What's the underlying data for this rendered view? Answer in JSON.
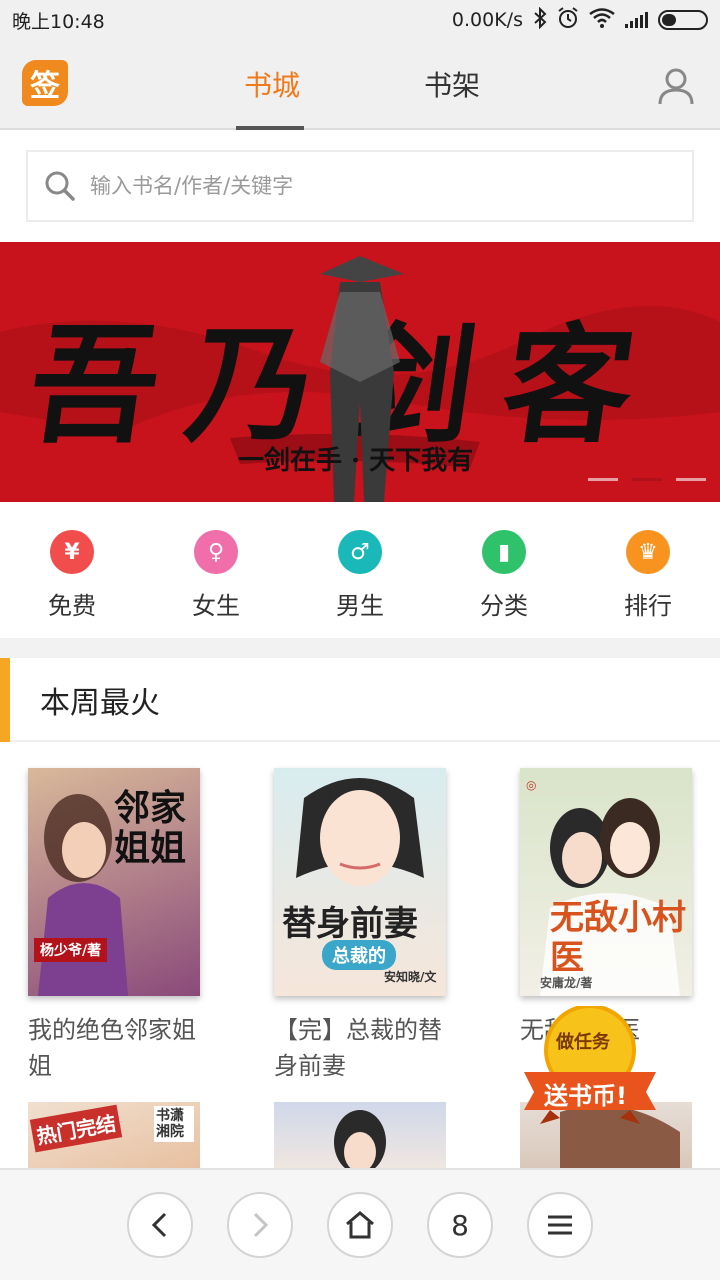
{
  "status_bar": {
    "time": "晚上10:48",
    "network_speed": "0.00K/s"
  },
  "header": {
    "logo_text": "签",
    "tabs": [
      {
        "label": "书城",
        "active": true
      },
      {
        "label": "书架",
        "active": false
      }
    ]
  },
  "search": {
    "placeholder": "输入书名/作者/关键字"
  },
  "banner": {
    "title": "吾乃剑客",
    "subtitle": "一剑在手 · 天下我有",
    "active_dot": 2,
    "dot_count": 3
  },
  "categories": [
    {
      "label": "免费",
      "icon": "yen-icon",
      "glyph": "¥",
      "color": "#f24d4d"
    },
    {
      "label": "女生",
      "icon": "female-icon",
      "glyph": "♀",
      "color": "#f06ea9"
    },
    {
      "label": "男生",
      "icon": "male-icon",
      "glyph": "♂",
      "color": "#1ab8b8"
    },
    {
      "label": "分类",
      "icon": "book-icon",
      "glyph": "▮",
      "color": "#2fc26a"
    },
    {
      "label": "排行",
      "icon": "trophy-icon",
      "glyph": "♛",
      "color": "#f7931e"
    }
  ],
  "section": {
    "title": "本周最火"
  },
  "books": [
    {
      "name": "我的绝色邻家姐姐",
      "cover_title": "邻家姐姐",
      "cover_author": "杨少爷/著",
      "cover_colors": [
        "#c7a58a",
        "#7a3b6e"
      ]
    },
    {
      "name": "【完】总裁的替身前妻",
      "cover_title": "替身前妻",
      "cover_subtitle": "总裁的",
      "cover_author": "安知晓/文",
      "cover_colors": [
        "#d8ecef",
        "#f6d8c4"
      ]
    },
    {
      "name": "无敌小村医",
      "cover_title": "无敌小村医",
      "cover_author": "安庸龙/著",
      "cover_colors": [
        "#d9e4c9",
        "#f2efe6"
      ]
    }
  ],
  "second_row_covers": [
    {
      "text": "热门完结",
      "corner": "书潇湘院",
      "colors": [
        "#f0e0d0",
        "#c9302c"
      ]
    },
    {
      "text": "",
      "corner": "",
      "colors": [
        "#d0d8ea",
        "#efe6e0"
      ]
    },
    {
      "text": "",
      "corner": "",
      "colors": [
        "#e6ddd5",
        "#8b5a44"
      ]
    }
  ],
  "reward_badge": {
    "line1": "做任务",
    "line2": "送书币!"
  },
  "bottom_bar": {
    "tab_count": "8"
  },
  "colors": {
    "accent": "#f07a1a",
    "banner_red": "#c8131c"
  }
}
